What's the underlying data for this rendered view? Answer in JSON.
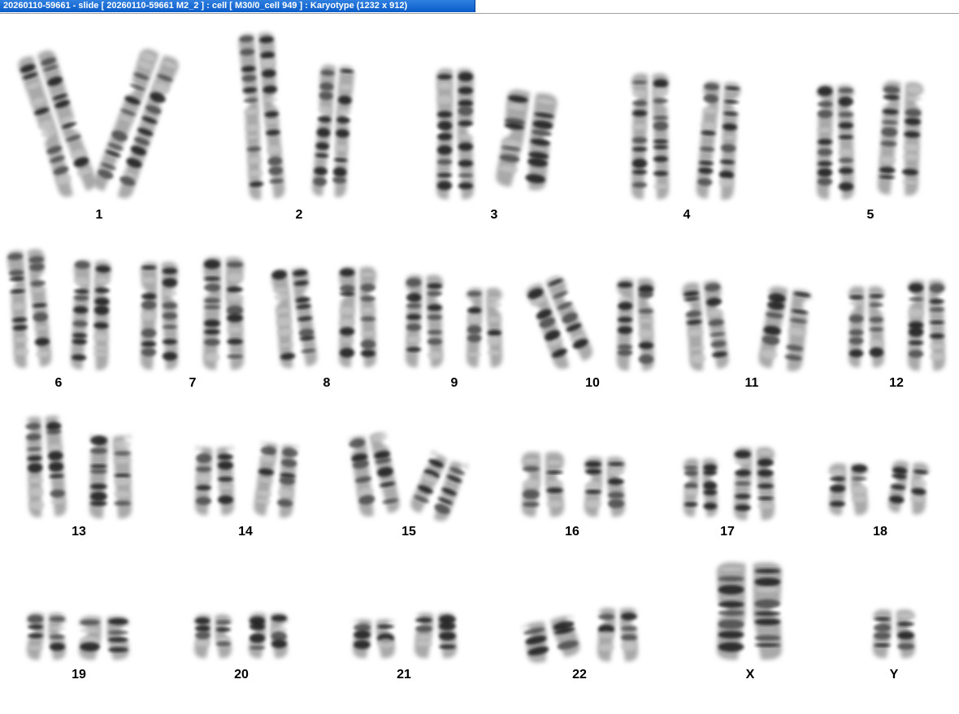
{
  "window": {
    "title": "20260110-59661 - slide [ 20260110-59661 M2_2 ] : cell [ M30/0_cell 949 ] : Karyotype  (1232 x 912)"
  },
  "karyotype": {
    "chromosomes": [
      {
        "label": "1"
      },
      {
        "label": "2"
      },
      {
        "label": "3"
      },
      {
        "label": "4"
      },
      {
        "label": "5"
      },
      {
        "label": "6"
      },
      {
        "label": "7"
      },
      {
        "label": "8"
      },
      {
        "label": "9"
      },
      {
        "label": "10"
      },
      {
        "label": "11"
      },
      {
        "label": "12"
      },
      {
        "label": "13"
      },
      {
        "label": "14"
      },
      {
        "label": "15"
      },
      {
        "label": "16"
      },
      {
        "label": "17"
      },
      {
        "label": "18"
      },
      {
        "label": "19"
      },
      {
        "label": "20"
      },
      {
        "label": "21"
      },
      {
        "label": "22"
      },
      {
        "label": "X"
      },
      {
        "label": "Y"
      }
    ]
  }
}
